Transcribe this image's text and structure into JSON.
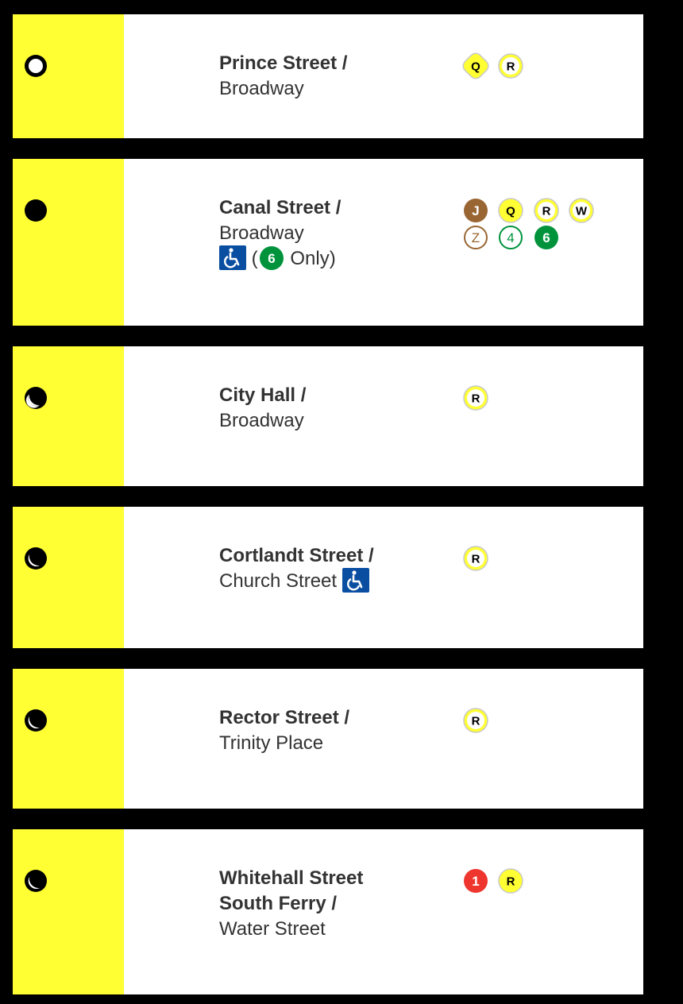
{
  "stations": [
    {
      "service_icon": "service-full-time-open-circle-icon",
      "name_bold": "Prince Street",
      "name_sep": " /",
      "name_second": "Broadway",
      "accessible": false,
      "lines": [
        [
          "Q",
          "R"
        ]
      ]
    },
    {
      "service_icon": "service-full-time-solid-circle-icon",
      "name_bold": "Canal Street",
      "name_sep": " /",
      "name_second": "Broadway",
      "accessible_note_open": " (",
      "accessible_note_line": "6",
      "accessible_note_close": " Only)",
      "lines": [
        [
          "J",
          "Q",
          "R",
          "W"
        ],
        [
          "Z",
          "4",
          "6"
        ]
      ]
    },
    {
      "service_icon": "service-part-time-crescent-icon",
      "name_bold": "City Hall",
      "name_sep": " /",
      "name_second": "Broadway",
      "lines": [
        [
          "R"
        ]
      ]
    },
    {
      "service_icon": "service-part-time-crescent-icon",
      "name_bold": "Cortlandt Street",
      "name_sep": " /",
      "name_second": "Church Street",
      "accessible_inline": true,
      "lines": [
        [
          "R"
        ]
      ]
    },
    {
      "service_icon": "service-part-time-crescent-icon",
      "name_bold": "Rector Street",
      "name_sep": " /",
      "name_second": "Trinity Place",
      "lines": [
        [
          "R"
        ]
      ]
    },
    {
      "service_icon": "service-part-time-crescent-icon",
      "name_bold": "Whitehall Street",
      "name_bold_2": "South Ferry",
      "name_sep": " /",
      "name_second": "Water Street",
      "lines": [
        [
          "1",
          "R"
        ]
      ]
    }
  ],
  "line_colors": {
    "Q": {
      "fill": "#ffff33",
      "text": "#000000",
      "style": "express"
    },
    "R": {
      "fill": "#ffff33",
      "text": "#000000",
      "style": "local"
    },
    "W": {
      "fill": "#ffff33",
      "text": "#000000",
      "style": "local"
    },
    "J": {
      "fill": "#996633",
      "text": "#ffffff",
      "style": "express"
    },
    "Z": {
      "fill": "#996633",
      "text": "#996633",
      "style": "outline"
    },
    "4": {
      "fill": "#00933c",
      "text": "#00933c",
      "style": "outline"
    },
    "6": {
      "fill": "#00933c",
      "text": "#ffffff",
      "style": "solid"
    },
    "1": {
      "fill": "#ee352e",
      "text": "#ffffff",
      "style": "solid"
    }
  },
  "accessible_icon": "wheelchair-icon",
  "accent_yellow": "#ffff33",
  "access_blue": "#0a4ea1"
}
